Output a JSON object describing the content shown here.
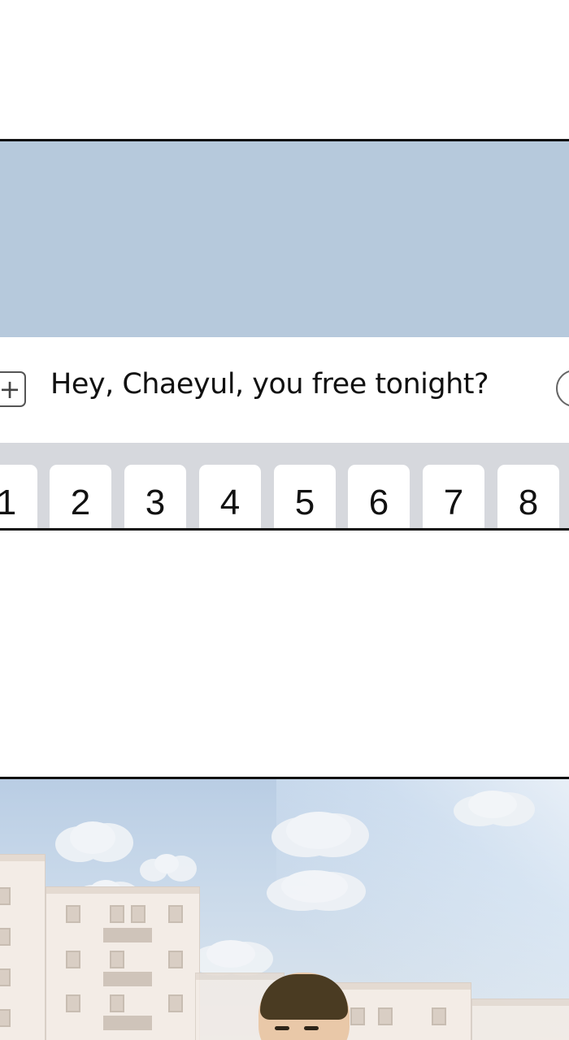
{
  "chat": {
    "plus_icon": "plus-icon",
    "message_text": "Hey, Chaeyul, you free tonight?",
    "send_icon": "send-icon",
    "colors": {
      "chat_background": "#b6c9dc",
      "keyboard_background": "#d6d8dd",
      "key_background": "#ffffff"
    }
  },
  "keyboard": {
    "keys": [
      "1",
      "2",
      "3",
      "4",
      "5",
      "6",
      "7",
      "8"
    ]
  }
}
